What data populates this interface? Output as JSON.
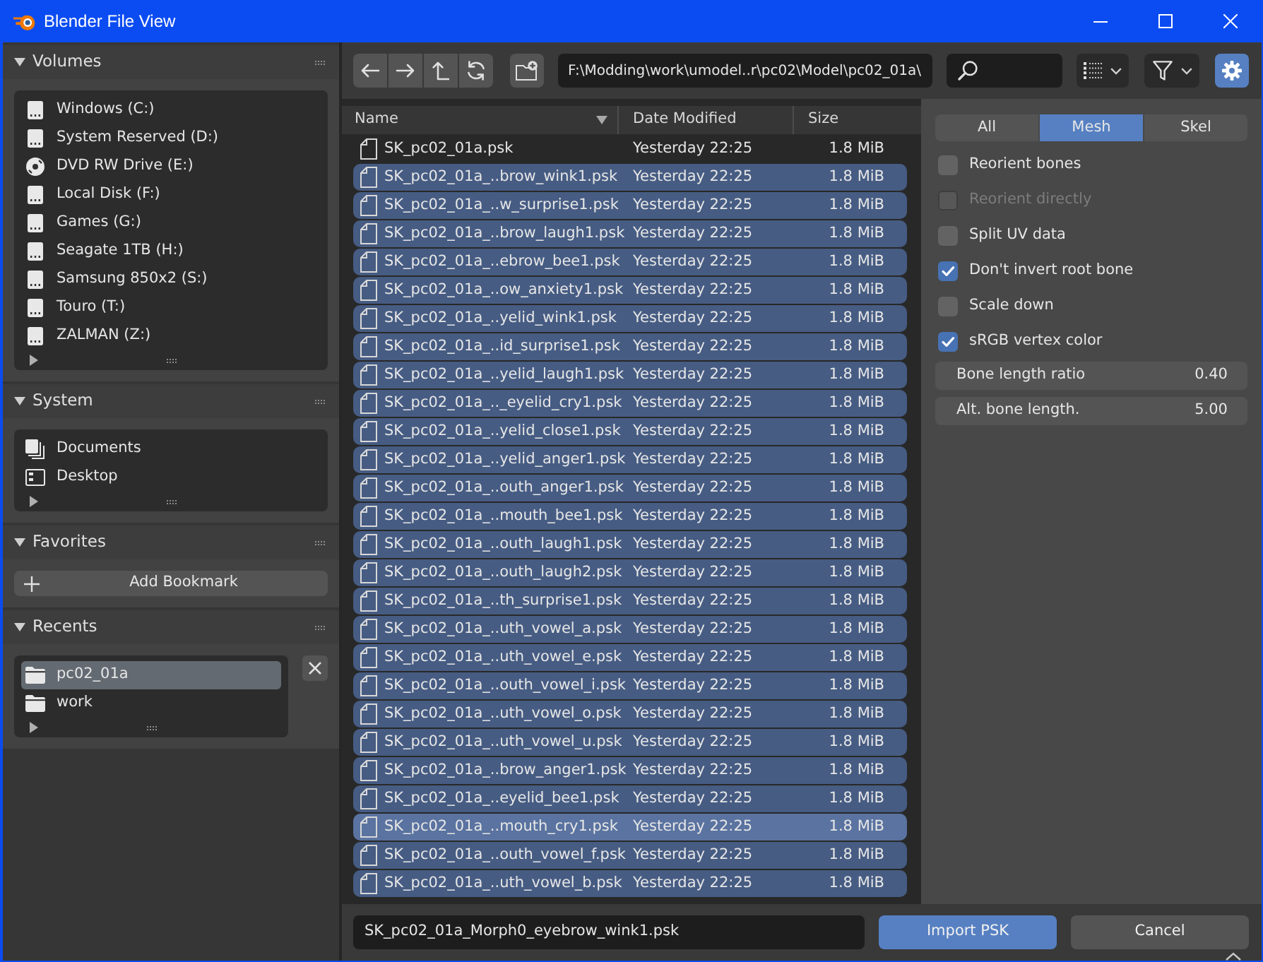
{
  "window": {
    "title": "Blender File View"
  },
  "sidebar": {
    "panels": [
      {
        "kind": "list",
        "title": "Volumes",
        "expanded": true,
        "items": [
          {
            "kind": "drive",
            "label": "Windows (C:)",
            "selected": false
          },
          {
            "kind": "drive",
            "label": "System Reserved (D:)",
            "selected": false
          },
          {
            "kind": "disc",
            "label": "DVD RW Drive (E:)",
            "selected": false
          },
          {
            "kind": "drive",
            "label": "Local Disk (F:)",
            "selected": false
          },
          {
            "kind": "drive",
            "label": "Games (G:)",
            "selected": false
          },
          {
            "kind": "drive",
            "label": "Seagate 1TB (H:)",
            "selected": false
          },
          {
            "kind": "drive",
            "label": "Samsung 850x2 (S:)",
            "selected": false
          },
          {
            "kind": "drive",
            "label": "Touro (T:)",
            "selected": false
          },
          {
            "kind": "drive",
            "label": "ZALMAN (Z:)",
            "selected": false
          }
        ]
      },
      {
        "kind": "list",
        "title": "System",
        "expanded": true,
        "items": [
          {
            "kind": "documents",
            "label": "Documents",
            "selected": false
          },
          {
            "kind": "desktop",
            "label": "Desktop",
            "selected": false
          }
        ]
      },
      {
        "kind": "button",
        "title": "Favorites",
        "expanded": true,
        "button": "Add Bookmark"
      },
      {
        "kind": "list",
        "title": "Recents",
        "expanded": true,
        "clear_button": true,
        "items": [
          {
            "kind": "folder",
            "label": "pc02_01a",
            "selected": true
          },
          {
            "kind": "folder",
            "label": "work",
            "selected": false
          }
        ]
      }
    ]
  },
  "toolbar": {
    "path": "F:\\Modding\\work\\umodel..r\\pc02\\Model\\pc02_01a\\",
    "settings_on": true
  },
  "file_list": {
    "columns": [
      {
        "label": "Name",
        "sorted": true
      },
      {
        "label": "Date Modified",
        "sorted": false
      },
      {
        "label": "Size",
        "sorted": false
      }
    ],
    "rows": [
      {
        "name": "SK_pc02_01a.psk",
        "date": "Yesterday 22:25",
        "size": "1.8 MiB",
        "selected": false,
        "active": false
      },
      {
        "name": "SK_pc02_01a_..brow_wink1.psk",
        "date": "Yesterday 22:25",
        "size": "1.8 MiB",
        "selected": true,
        "active": false
      },
      {
        "name": "SK_pc02_01a_..w_surprise1.psk",
        "date": "Yesterday 22:25",
        "size": "1.8 MiB",
        "selected": true,
        "active": false
      },
      {
        "name": "SK_pc02_01a_..brow_laugh1.psk",
        "date": "Yesterday 22:25",
        "size": "1.8 MiB",
        "selected": true,
        "active": false
      },
      {
        "name": "SK_pc02_01a_..ebrow_bee1.psk",
        "date": "Yesterday 22:25",
        "size": "1.8 MiB",
        "selected": true,
        "active": false
      },
      {
        "name": "SK_pc02_01a_..ow_anxiety1.psk",
        "date": "Yesterday 22:25",
        "size": "1.8 MiB",
        "selected": true,
        "active": false
      },
      {
        "name": "SK_pc02_01a_..yelid_wink1.psk",
        "date": "Yesterday 22:25",
        "size": "1.8 MiB",
        "selected": true,
        "active": false
      },
      {
        "name": "SK_pc02_01a_..id_surprise1.psk",
        "date": "Yesterday 22:25",
        "size": "1.8 MiB",
        "selected": true,
        "active": false
      },
      {
        "name": "SK_pc02_01a_..yelid_laugh1.psk",
        "date": "Yesterday 22:25",
        "size": "1.8 MiB",
        "selected": true,
        "active": false
      },
      {
        "name": "SK_pc02_01a_.._eyelid_cry1.psk",
        "date": "Yesterday 22:25",
        "size": "1.8 MiB",
        "selected": true,
        "active": false
      },
      {
        "name": "SK_pc02_01a_..yelid_close1.psk",
        "date": "Yesterday 22:25",
        "size": "1.8 MiB",
        "selected": true,
        "active": false
      },
      {
        "name": "SK_pc02_01a_..yelid_anger1.psk",
        "date": "Yesterday 22:25",
        "size": "1.8 MiB",
        "selected": true,
        "active": false
      },
      {
        "name": "SK_pc02_01a_..outh_anger1.psk",
        "date": "Yesterday 22:25",
        "size": "1.8 MiB",
        "selected": true,
        "active": false
      },
      {
        "name": "SK_pc02_01a_..mouth_bee1.psk",
        "date": "Yesterday 22:25",
        "size": "1.8 MiB",
        "selected": true,
        "active": false
      },
      {
        "name": "SK_pc02_01a_..outh_laugh1.psk",
        "date": "Yesterday 22:25",
        "size": "1.8 MiB",
        "selected": true,
        "active": false
      },
      {
        "name": "SK_pc02_01a_..outh_laugh2.psk",
        "date": "Yesterday 22:25",
        "size": "1.8 MiB",
        "selected": true,
        "active": false
      },
      {
        "name": "SK_pc02_01a_..th_surprise1.psk",
        "date": "Yesterday 22:25",
        "size": "1.8 MiB",
        "selected": true,
        "active": false
      },
      {
        "name": "SK_pc02_01a_..uth_vowel_a.psk",
        "date": "Yesterday 22:25",
        "size": "1.8 MiB",
        "selected": true,
        "active": false
      },
      {
        "name": "SK_pc02_01a_..uth_vowel_e.psk",
        "date": "Yesterday 22:25",
        "size": "1.8 MiB",
        "selected": true,
        "active": false
      },
      {
        "name": "SK_pc02_01a_..outh_vowel_i.psk",
        "date": "Yesterday 22:25",
        "size": "1.8 MiB",
        "selected": true,
        "active": false
      },
      {
        "name": "SK_pc02_01a_..uth_vowel_o.psk",
        "date": "Yesterday 22:25",
        "size": "1.8 MiB",
        "selected": true,
        "active": false
      },
      {
        "name": "SK_pc02_01a_..uth_vowel_u.psk",
        "date": "Yesterday 22:25",
        "size": "1.8 MiB",
        "selected": true,
        "active": false
      },
      {
        "name": "SK_pc02_01a_..brow_anger1.psk",
        "date": "Yesterday 22:25",
        "size": "1.8 MiB",
        "selected": true,
        "active": false
      },
      {
        "name": "SK_pc02_01a_..eyelid_bee1.psk",
        "date": "Yesterday 22:25",
        "size": "1.8 MiB",
        "selected": true,
        "active": false
      },
      {
        "name": "SK_pc02_01a_..mouth_cry1.psk",
        "date": "Yesterday 22:25",
        "size": "1.8 MiB",
        "selected": true,
        "active": true
      },
      {
        "name": "SK_pc02_01a_..outh_vowel_f.psk",
        "date": "Yesterday 22:25",
        "size": "1.8 MiB",
        "selected": true,
        "active": false
      },
      {
        "name": "SK_pc02_01a_..uth_vowel_b.psk",
        "date": "Yesterday 22:25",
        "size": "1.8 MiB",
        "selected": true,
        "active": false
      }
    ]
  },
  "options": {
    "tabs": [
      {
        "label": "All",
        "selected": false
      },
      {
        "label": "Mesh",
        "selected": true
      },
      {
        "label": "Skel",
        "selected": false
      }
    ],
    "settings": [
      {
        "kind": "checkbox",
        "label": "Reorient bones",
        "checked": false,
        "disabled": false
      },
      {
        "kind": "checkbox",
        "label": "Reorient directly",
        "checked": false,
        "disabled": true
      },
      {
        "kind": "checkbox",
        "label": "Split UV data",
        "checked": false,
        "disabled": false
      },
      {
        "kind": "checkbox",
        "label": "Don't invert root bone",
        "checked": true,
        "disabled": false
      },
      {
        "kind": "checkbox",
        "label": "Scale down",
        "checked": false,
        "disabled": false
      },
      {
        "kind": "checkbox",
        "label": "sRGB vertex color",
        "checked": true,
        "disabled": false
      },
      {
        "kind": "number",
        "label": "Bone length ratio",
        "value": "0.40"
      },
      {
        "kind": "number",
        "label": "Alt. bone length.",
        "value": "5.00"
      }
    ]
  },
  "footer": {
    "filename": "SK_pc02_01a_Morph0_eyebrow_wink1.psk",
    "buttons": [
      {
        "label": "Import PSK",
        "primary": true
      },
      {
        "label": "Cancel",
        "primary": false
      }
    ]
  }
}
